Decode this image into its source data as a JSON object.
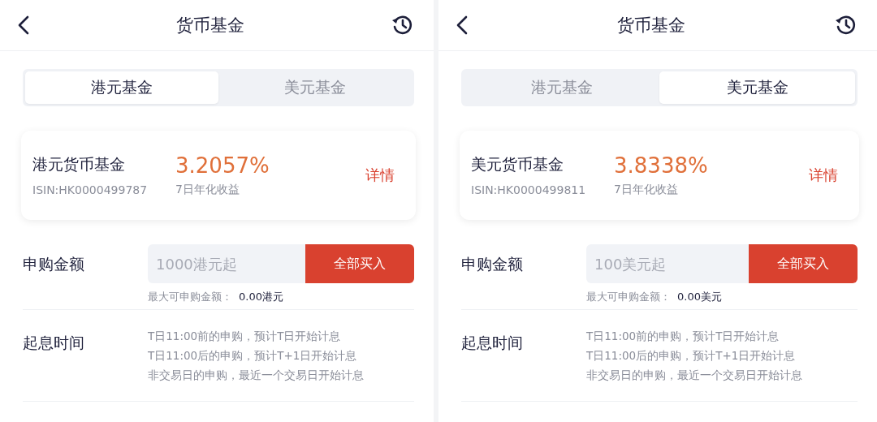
{
  "screens": [
    {
      "title": "货币基金",
      "tabs": [
        {
          "label": "港元基金",
          "selected": true
        },
        {
          "label": "美元基金",
          "selected": false
        }
      ],
      "fund": {
        "name": "港元货币基金",
        "isin": "ISIN:HK0000499787",
        "yield": "3.2057%",
        "yield_label": "7日年化收益",
        "details": "详情"
      },
      "purchase": {
        "label": "申购金额",
        "placeholder": "1000港元起",
        "button": "全部买入",
        "max_label": "最大可申购金额：",
        "max_value": "0.00港元"
      },
      "interest": {
        "label": "起息时间",
        "lines": [
          "T日11:00前的申购，预计T日开始计息",
          "T日11:00后的申购，预计T+1日开始计息",
          "非交易日的申购，最近一个交易日开始计息"
        ]
      }
    },
    {
      "title": "货币基金",
      "tabs": [
        {
          "label": "港元基金",
          "selected": false
        },
        {
          "label": "美元基金",
          "selected": true
        }
      ],
      "fund": {
        "name": "美元货币基金",
        "isin": "ISIN:HK0000499811",
        "yield": "3.8338%",
        "yield_label": "7日年化收益",
        "details": "详情"
      },
      "purchase": {
        "label": "申购金额",
        "placeholder": "100美元起",
        "button": "全部买入",
        "max_label": "最大可申购金额：",
        "max_value": "0.00美元"
      },
      "interest": {
        "label": "起息时间",
        "lines": [
          "T日11:00前的申购，预计T日开始计息",
          "T日11:00后的申购，预计T+1日开始计息",
          "非交易日的申购，最近一个交易日开始计息"
        ]
      }
    }
  ]
}
